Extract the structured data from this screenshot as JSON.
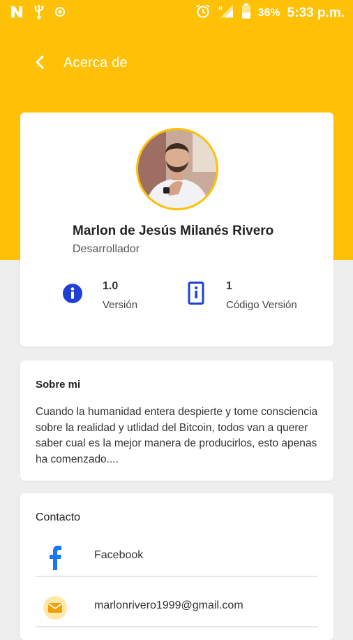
{
  "status_bar": {
    "battery_percent": "36%",
    "time": "5:33 p.m."
  },
  "app_bar": {
    "title": "Acerca de"
  },
  "profile": {
    "name": "Marlon de Jesús Milanés Rivero",
    "role": "Desarrollador",
    "stats": [
      {
        "value": "1.0",
        "label": "Versión",
        "icon": "info-icon"
      },
      {
        "value": "1",
        "label": "Código Versión",
        "icon": "device-info-icon"
      }
    ]
  },
  "about": {
    "title": "Sobre mi",
    "text": "Cuando la humanidad entera despierte y tome consciencia sobre la realidad y utlidad del Bitcoin, todos van a querer saber cual es la mejor manera de producirlos, esto apenas ha comenzado...."
  },
  "contact": {
    "title": "Contacto",
    "items": [
      {
        "label": "Facebook",
        "icon": "facebook-icon"
      },
      {
        "label": "marlonrivero1999@gmail.com",
        "icon": "email-icon"
      }
    ]
  },
  "colors": {
    "accent": "#ffc107",
    "info_blue": "#1e40d8",
    "facebook_blue": "#1877f2",
    "background": "#eeeeee"
  }
}
